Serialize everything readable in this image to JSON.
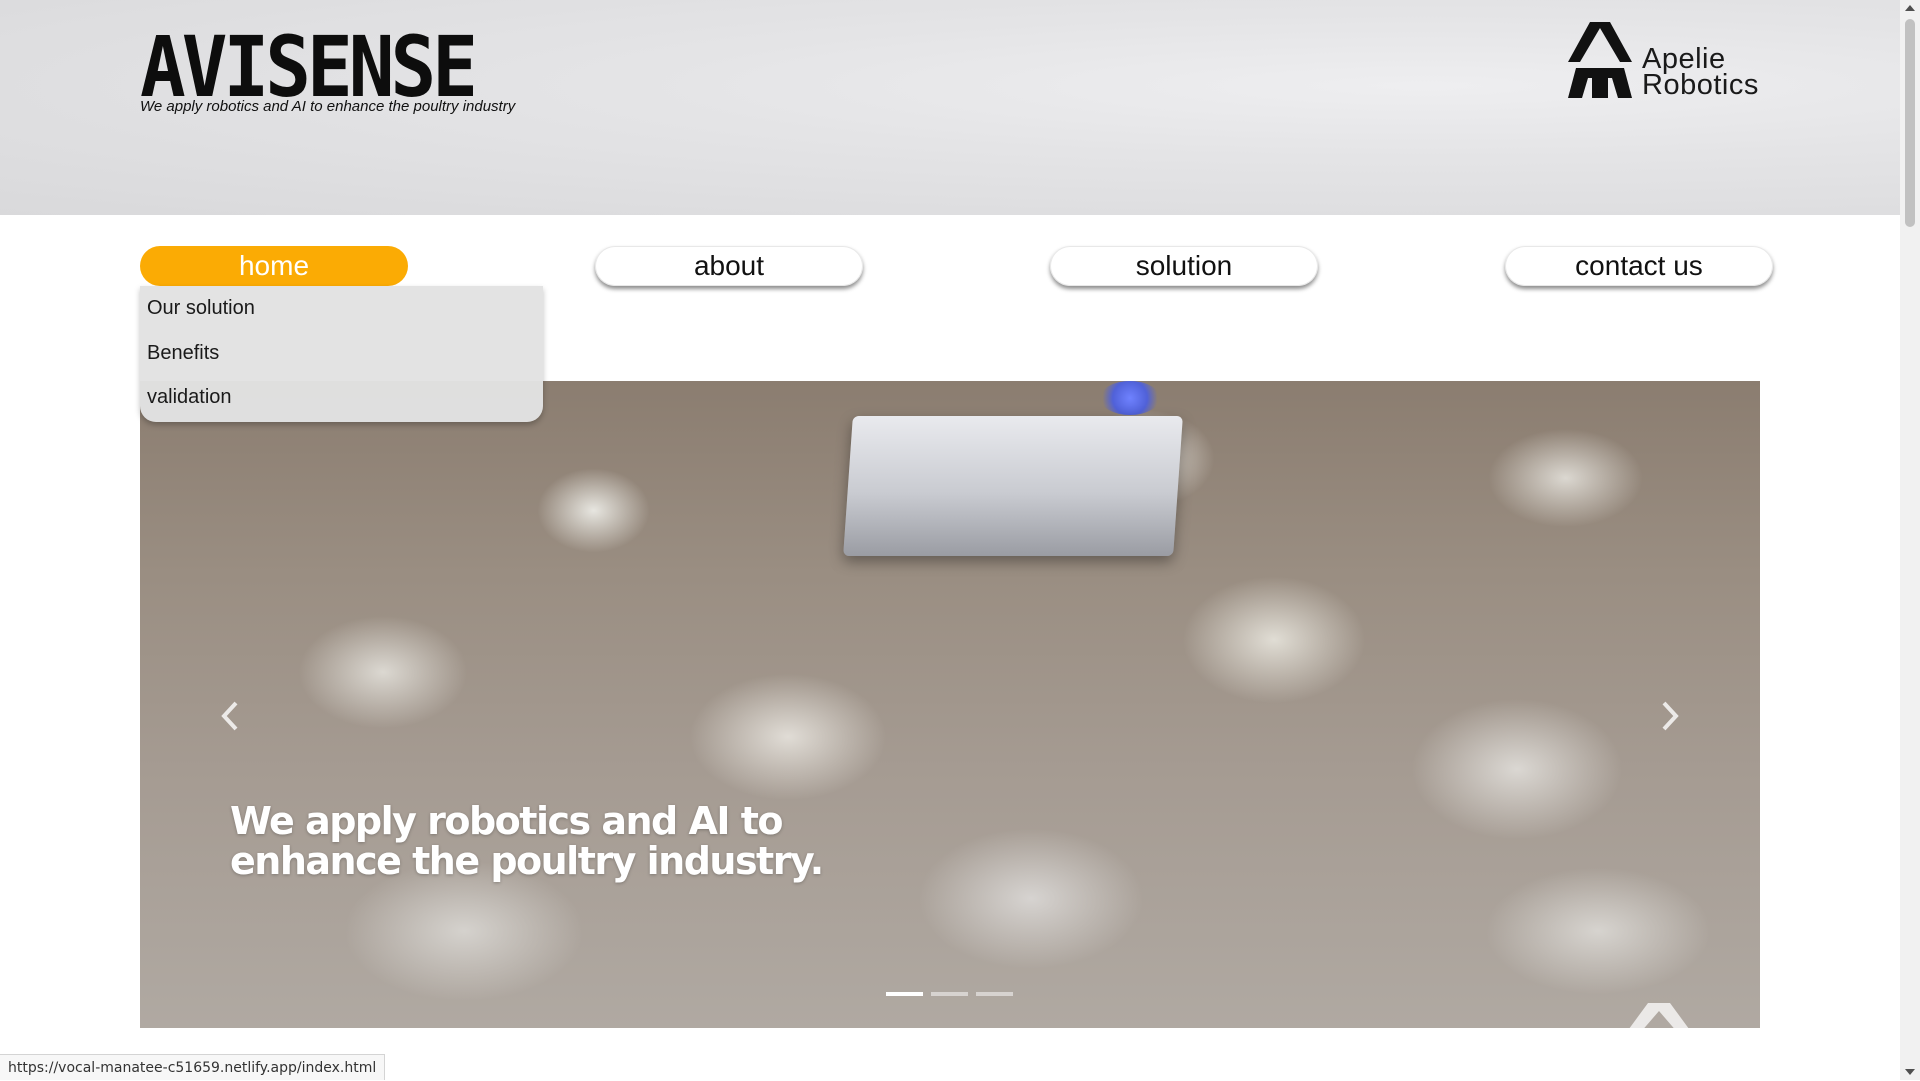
{
  "brand": {
    "name": "AVISENSE",
    "tagline": "We apply robotics and AI to enhance the poultry industry"
  },
  "partner": {
    "line1": "Apelie",
    "line2": "Robotics",
    "icon": "apelie-robotics-logo-icon"
  },
  "nav": {
    "items": [
      {
        "label": "home",
        "active": true
      },
      {
        "label": "about",
        "active": false
      },
      {
        "label": "solution",
        "active": false
      },
      {
        "label": "contact us",
        "active": false
      }
    ],
    "active_color": "#fbab04"
  },
  "dropdown": {
    "items": [
      "Our solution",
      "Benefits",
      "validation"
    ]
  },
  "carousel": {
    "caption_line1": "We apply robotics and AI to",
    "caption_line2": "enhance the poultry industry.",
    "slide_count": 3,
    "active_slide": 1,
    "prev_icon": "chevron-left-icon",
    "next_icon": "chevron-right-icon"
  },
  "status_bar": {
    "url": "https://vocal-manatee-c51659.netlify.app/index.html"
  }
}
